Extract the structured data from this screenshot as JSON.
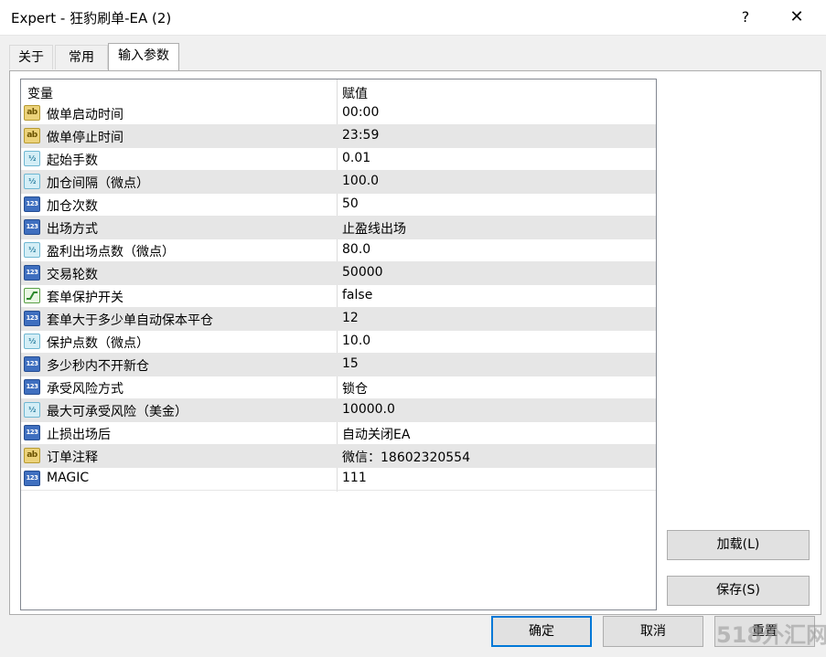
{
  "window": {
    "title": "Expert - 狂豹刷单-EA (2)",
    "help_label": "?",
    "close_label": "✕"
  },
  "tabs": [
    {
      "label": "关于",
      "active": false
    },
    {
      "label": "常用",
      "active": false
    },
    {
      "label": "输入参数",
      "active": true
    }
  ],
  "table": {
    "headers": {
      "variable": "变量",
      "value": "赋值"
    },
    "rows": [
      {
        "type": "string",
        "icon": "ab",
        "name": "做单启动时间",
        "value": "00:00"
      },
      {
        "type": "string",
        "icon": "ab",
        "name": "做单停止时间",
        "value": "23:59"
      },
      {
        "type": "double",
        "icon": "½",
        "name": "起始手数",
        "value": "0.01"
      },
      {
        "type": "double",
        "icon": "½",
        "name": "加仓间隔（微点）",
        "value": "100.0"
      },
      {
        "type": "integer",
        "icon": "123",
        "name": "加仓次数",
        "value": "50"
      },
      {
        "type": "integer",
        "icon": "123",
        "name": "出场方式",
        "value": "止盈线出场"
      },
      {
        "type": "double",
        "icon": "½",
        "name": "盈利出场点数（微点）",
        "value": "80.0"
      },
      {
        "type": "integer",
        "icon": "123",
        "name": "交易轮数",
        "value": "50000"
      },
      {
        "type": "bool",
        "icon": "",
        "name": "套单保护开关",
        "value": "false"
      },
      {
        "type": "integer",
        "icon": "123",
        "name": "套单大于多少单自动保本平仓",
        "value": "12"
      },
      {
        "type": "double",
        "icon": "½",
        "name": "保护点数（微点）",
        "value": "10.0"
      },
      {
        "type": "integer",
        "icon": "123",
        "name": "多少秒内不开新仓",
        "value": "15"
      },
      {
        "type": "integer",
        "icon": "123",
        "name": "承受风险方式",
        "value": "锁仓"
      },
      {
        "type": "double",
        "icon": "½",
        "name": "最大可承受风险（美金）",
        "value": "10000.0"
      },
      {
        "type": "integer",
        "icon": "123",
        "name": "止损出场后",
        "value": "自动关闭EA"
      },
      {
        "type": "string",
        "icon": "ab",
        "name": "订单注释",
        "value": "微信：18602320554"
      },
      {
        "type": "integer",
        "icon": "123",
        "name": "MAGIC",
        "value": "111"
      }
    ]
  },
  "buttons": {
    "load": "加载(L)",
    "save": "保存(S)",
    "ok": "确定",
    "cancel": "取消",
    "reset": "重置"
  },
  "watermark": "518外汇网"
}
